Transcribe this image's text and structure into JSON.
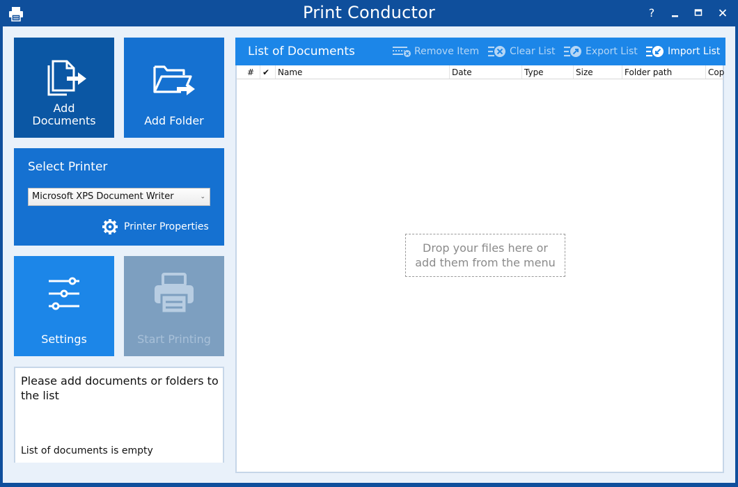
{
  "window": {
    "title": "Print Conductor",
    "help_label": "?",
    "close_label": "×"
  },
  "tiles": {
    "add_documents": "Add\nDocuments",
    "add_documents_line1": "Add",
    "add_documents_line2": "Documents",
    "add_folder": "Add Folder",
    "settings": "Settings",
    "start_printing": "Start Printing"
  },
  "printer": {
    "header": "Select Printer",
    "selected": "Microsoft XPS Document Writer",
    "properties_label": "Printer Properties"
  },
  "status": {
    "message": "Please add documents or folders to the list",
    "footer": "List of documents is empty"
  },
  "documents": {
    "header": "List of Documents",
    "toolbar": {
      "remove_item": "Remove Item",
      "clear_list": "Clear List",
      "export_list": "Export List",
      "import_list": "Import List"
    },
    "columns": [
      "#",
      "✔",
      "Name",
      "Date",
      "Type",
      "Size",
      "Folder path",
      "Cop"
    ],
    "drop_hint_line1": "Drop your files here or",
    "drop_hint_line2": "add them from the menu"
  },
  "colors": {
    "titlebar": "#0f4f9c",
    "tile_dark": "#0b57a4",
    "tile_mid": "#1571d1",
    "tile_light": "#1c86e8",
    "tile_disabled": "#7d9fc0",
    "client_bg": "#e9f1fa"
  }
}
